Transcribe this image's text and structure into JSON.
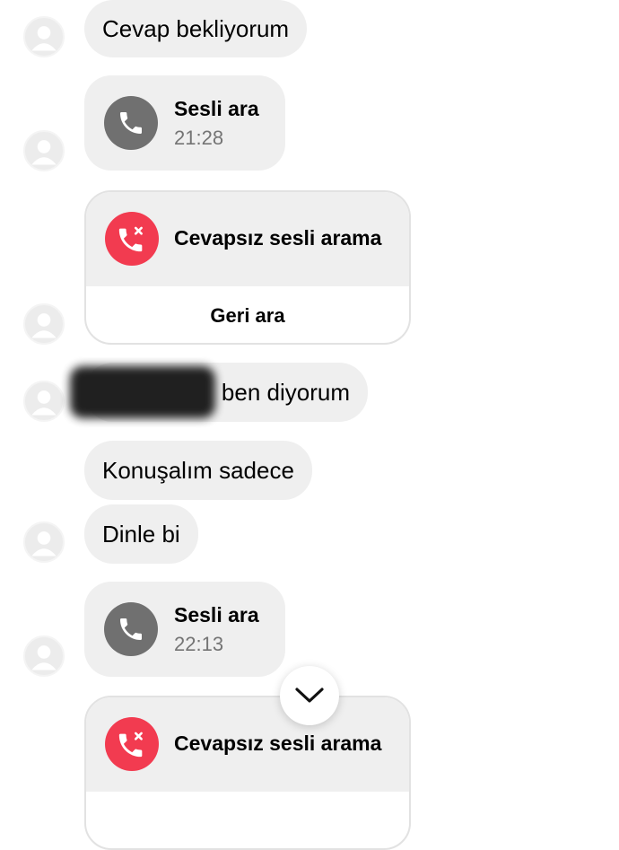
{
  "messages": {
    "m1": "Cevap bekliyorum",
    "call1": {
      "title": "Sesli ara",
      "time": "21:28"
    },
    "missed1": {
      "title": "Cevapsız sesli arama",
      "action": "Geri ara"
    },
    "m2_visible": "ben diyorum",
    "m3": "Konuşalım sadece",
    "m4": "Dinle bi",
    "call2": {
      "title": "Sesli ara",
      "time": "22:13"
    },
    "missed2": {
      "title": "Cevapsız sesli arama"
    }
  },
  "icons": {
    "avatar": "default-avatar-icon",
    "call": "phone-icon",
    "missed": "missed-call-icon",
    "scroll": "chevron-down-icon"
  },
  "colors": {
    "bubble": "#efefef",
    "missed_red": "#f23b50",
    "call_gray": "#707070"
  }
}
